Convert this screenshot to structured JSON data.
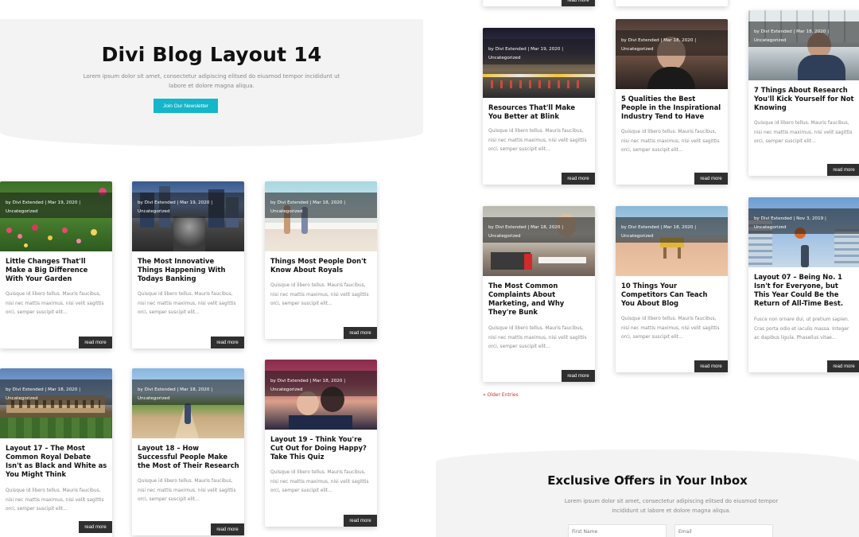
{
  "hero": {
    "title": "Divi Blog Layout 14",
    "subtitle": "Lorem ipsum dolor sit amet, consectetur adipiscing elitsed do eiusmod tempor incididunt ut labore et dolore magna aliqua.",
    "button_label": "Join Our Newsletter"
  },
  "read_more_label": "read more",
  "left_posts": [
    {
      "author": "by Divi Extended",
      "date": "Mar 19, 2020",
      "category": "Uncategorized",
      "title": "Little Changes That'll Make a Big Difference With Your Garden",
      "excerpt": "Quisque id libero tellus. Mauris faucibus, nisi nec mattis maximus, nisi velit sagittis orci, semper suscipit elit..."
    },
    {
      "author": "by Divi Extended",
      "date": "Mar 19, 2020",
      "category": "Uncategorized",
      "title": "The Most Innovative Things Happening With Todays Banking",
      "excerpt": "Quisque id libero tellus. Mauris faucibus, nisi nec mattis maximus, nisi velit sagittis orci, semper suscipit elit..."
    },
    {
      "author": "by Divi Extended",
      "date": "Mar 18, 2020",
      "category": "Uncategorized",
      "title": "Things Most People Don't Know About Royals",
      "excerpt": "Quisque id libero tellus. Mauris faucibus, nisi nec mattis maximus, nisi velit sagittis orci, semper suscipit elit..."
    },
    {
      "author": "by Divi Extended",
      "date": "Mar 18, 2020",
      "category": "Uncategorized",
      "title": "Layout 17 – The Most Common Royal Debate Isn't as Black and White as You Might Think",
      "excerpt": "Quisque id libero tellus. Mauris faucibus, nisi nec mattis maximus, nisi velit sagittis orci, semper suscipit elit..."
    },
    {
      "author": "by Divi Extended",
      "date": "Mar 18, 2020",
      "category": "Uncategorized",
      "title": "Layout 18 – How Successful People Make the Most of Their Research",
      "excerpt": "Quisque id libero tellus. Mauris faucibus, nisi nec mattis maximus, nisi velit sagittis orci, semper suscipit elit..."
    },
    {
      "author": "by Divi Extended",
      "date": "Mar 18, 2020",
      "category": "Uncategorized",
      "title": "Layout 19 – Think You're Cut Out for Doing Happy? Take This Quiz",
      "excerpt": "Quisque id libero tellus. Mauris faucibus, nisi nec mattis maximus, nisi velit sagittis orci, semper suscipit elit..."
    }
  ],
  "right_posts": [
    {
      "author": "by Divi Extended",
      "date": "Mar 19, 2020",
      "category": "Uncategorized",
      "title": "Resources That'll Make You Better at Blink",
      "excerpt": "Quisque id libero tellus. Mauris faucibus, nisi nec mattis maximus, nisi velit sagittis orci, semper suscipit elit..."
    },
    {
      "author": "by Divi Extended",
      "date": "Mar 18, 2020",
      "category": "Uncategorized",
      "title": "5 Qualities the Best People in the Inspirational Industry Tend to Have",
      "excerpt": "Quisque id libero tellus. Mauris faucibus, nisi nec mattis maximus, nisi velit sagittis orci, semper suscipit elit..."
    },
    {
      "author": "by Divi Extended",
      "date": "Mar 18, 2020",
      "category": "Uncategorized",
      "title": "7 Things About Research You'll Kick Yourself for Not Knowing",
      "excerpt": "Quisque id libero tellus. Mauris faucibus, nisi nec mattis maximus, nisi velit sagittis orci, semper suscipit elit..."
    },
    {
      "author": "by Divi Extended",
      "date": "Mar 18, 2020",
      "category": "Uncategorized",
      "title": "The Most Common Complaints About Marketing, and Why They're Bunk",
      "excerpt": "Quisque id libero tellus. Mauris faucibus, nisi nec mattis maximus, nisi velit sagittis orci, semper suscipit elit..."
    },
    {
      "author": "by Divi Extended",
      "date": "Mar 18, 2020",
      "category": "Uncategorized",
      "title": "10 Things Your Competitors Can Teach You About Blog",
      "excerpt": "Quisque id libero tellus. Mauris faucibus, nisi nec mattis maximus, nisi velit sagittis orci, semper suscipit elit..."
    },
    {
      "author": "by Divi Extended",
      "date": "Nov 3, 2019",
      "category": "Uncategorized",
      "title": "Layout 07 – Being No. 1 Isn't for Everyone, but This Year Could Be the Return of All-Time Best.",
      "excerpt": "Fusce non ornare dui, ut pretium sapien. Cras porta odio et iaculis massa. Integer ac dapibus ligula. Phasellus vitae..."
    }
  ],
  "older_entries_label": "« Older Entries",
  "subscribe": {
    "title": "Exclusive Offers in Your Inbox",
    "text": "Lorem ipsum dolor sit amet, consectetur adipiscing elitsed do eiusmod tempor incididunt ut labore et dolore magna aliqua.",
    "first_name_placeholder": "First Name",
    "email_placeholder": "Email"
  }
}
